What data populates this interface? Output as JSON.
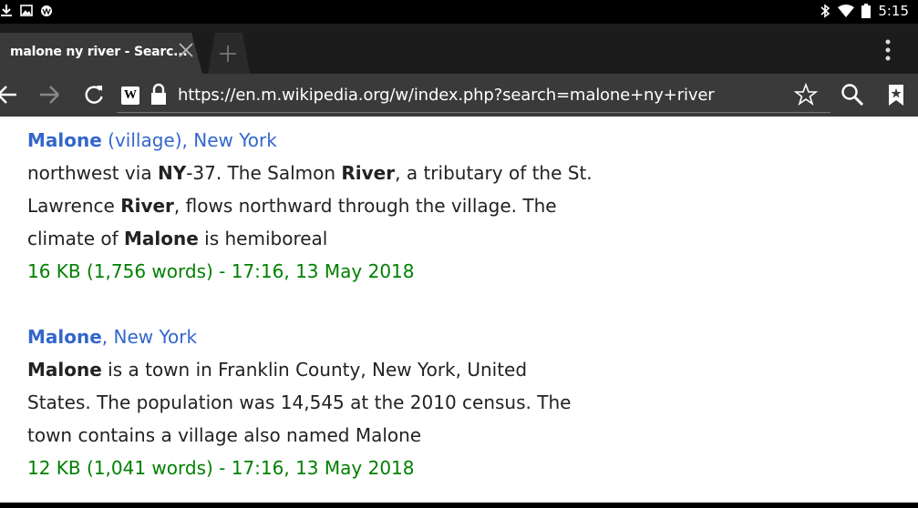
{
  "status_bar": {
    "time": "5:15",
    "left_icons": [
      "download-icon",
      "image-icon",
      "wikipedia-puzzle-icon"
    ],
    "right_icons": [
      "bluetooth-icon",
      "wifi-icon",
      "battery-icon"
    ]
  },
  "tab": {
    "title": "malone ny river - Searc..."
  },
  "toolbar": {
    "url": "https://en.m.wikipedia.org/w/index.php?search=malone+ny+river",
    "site_icon": "W"
  },
  "results": [
    {
      "title_bold": "Malone",
      "title_rest": " (village), New York",
      "lines": [
        [
          {
            "t": "northwest via ",
            "b": false
          },
          {
            "t": "NY",
            "b": true
          },
          {
            "t": "-37. The Salmon ",
            "b": false
          },
          {
            "t": "River",
            "b": true
          },
          {
            "t": ", a tributary of the St.",
            "b": false
          }
        ],
        [
          {
            "t": "Lawrence ",
            "b": false
          },
          {
            "t": "River",
            "b": true
          },
          {
            "t": ", flows northward through the village. The",
            "b": false
          }
        ],
        [
          {
            "t": "climate of ",
            "b": false
          },
          {
            "t": "Malone",
            "b": true
          },
          {
            "t": " is hemiboreal",
            "b": false
          }
        ]
      ],
      "meta": "16 KB (1,756 words) - 17:16, 13 May 2018"
    },
    {
      "title_bold": "Malone",
      "title_rest": ", New York",
      "lines": [
        [
          {
            "t": "Malone",
            "b": true
          },
          {
            "t": " is a town in Franklin County, New York, United",
            "b": false
          }
        ],
        [
          {
            "t": "States. The population was 14,545 at the 2010 census. The",
            "b": false
          }
        ],
        [
          {
            "t": "town contains a village also named Malone",
            "b": false
          }
        ]
      ],
      "meta": "12 KB (1,041 words) - 17:16, 13 May 2018"
    }
  ]
}
